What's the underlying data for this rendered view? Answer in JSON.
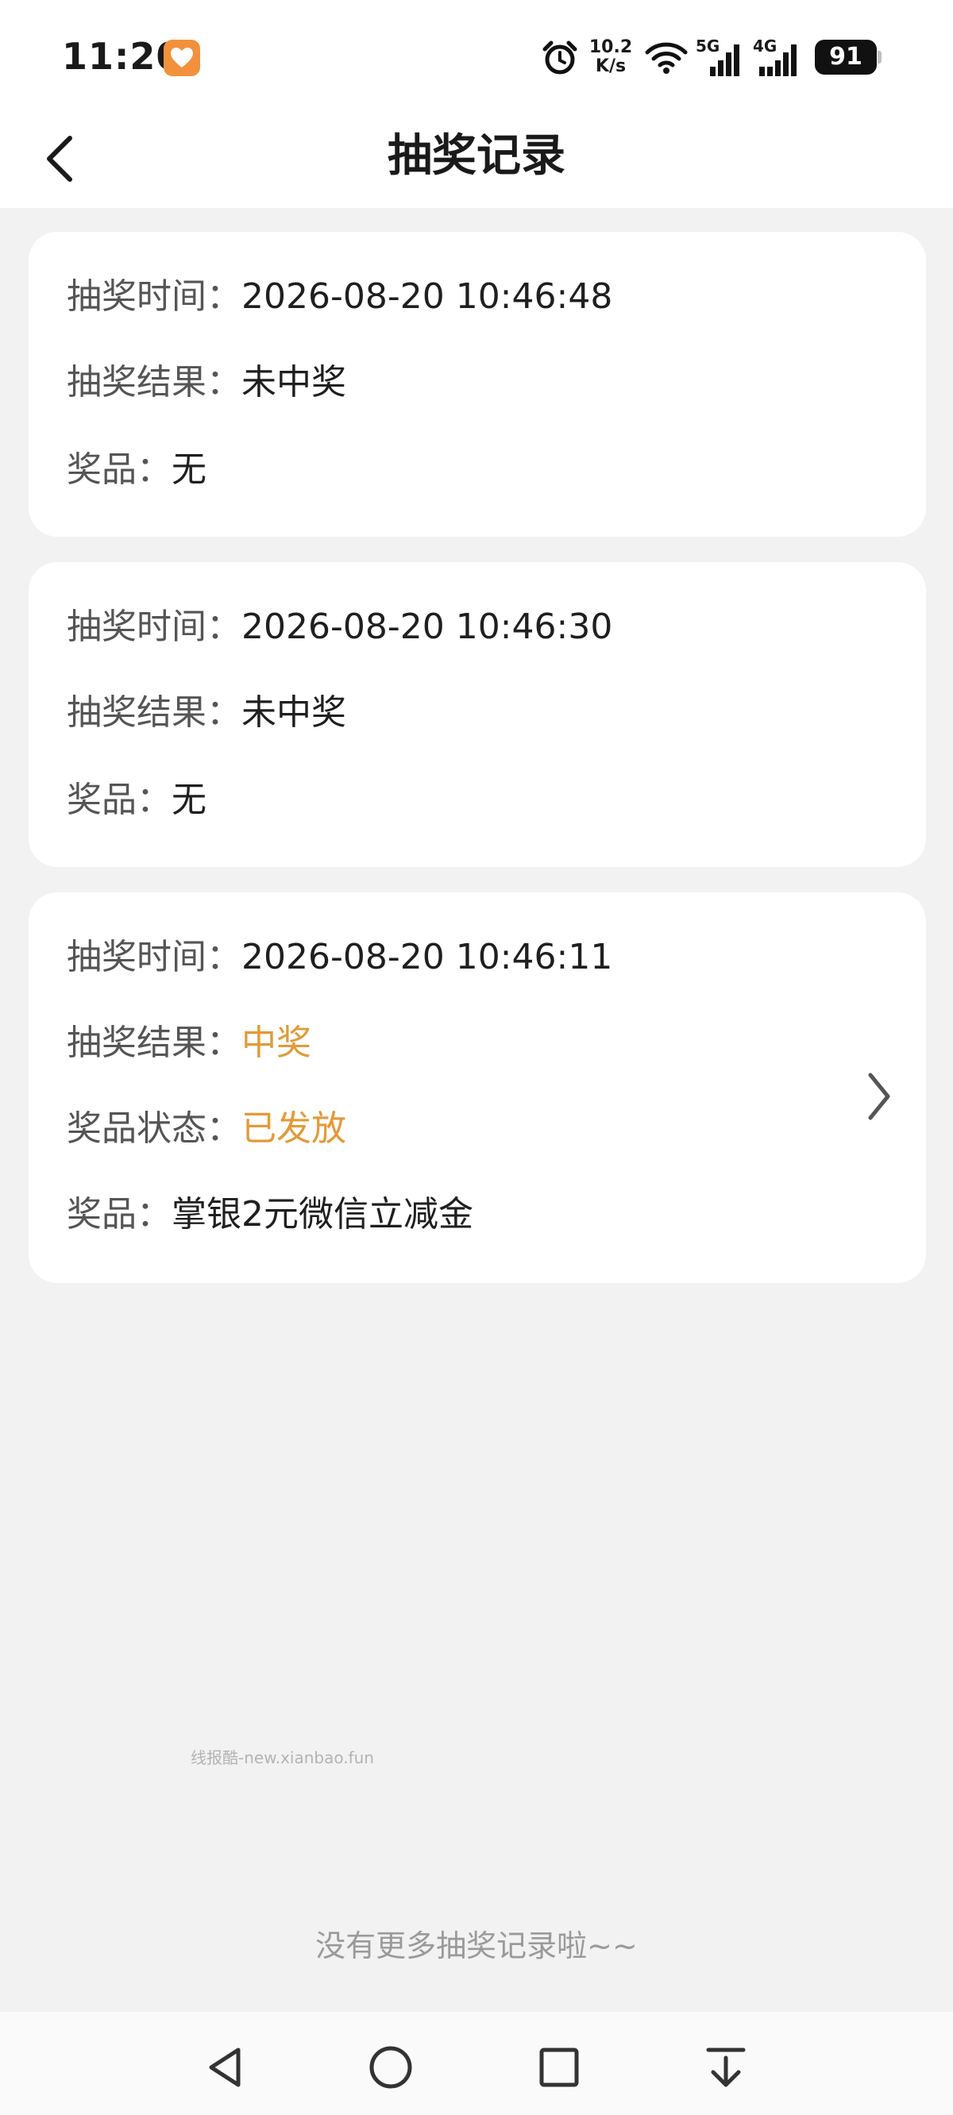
{
  "status_bar": {
    "time": "11:20",
    "app_badge_icon": "heart-app-icon",
    "net_speed_value": "10.2",
    "net_speed_unit": "K/s",
    "signal_1_label": "5G",
    "signal_2_label": "4G",
    "battery": "91"
  },
  "header": {
    "title": "抽奖记录",
    "back_icon": "chevron-left-icon"
  },
  "records": [
    {
      "time_label": "抽奖时间：",
      "time_value": "2026-08-20 10:46:48",
      "result_label": "抽奖结果：",
      "result_value": "未中奖",
      "prize_label": "奖品：",
      "prize_value": "无"
    },
    {
      "time_label": "抽奖时间：",
      "time_value": "2026-08-20 10:46:30",
      "result_label": "抽奖结果：",
      "result_value": "未中奖",
      "prize_label": "奖品：",
      "prize_value": "无"
    },
    {
      "time_label": "抽奖时间：",
      "time_value": "2026-08-20 10:46:11",
      "result_label": "抽奖结果：",
      "result_value": "中奖",
      "status_label": "奖品状态：",
      "status_value": "已发放",
      "prize_label": "奖品：",
      "prize_value": "掌银2元微信立减金"
    }
  ],
  "highlight_color": "#e39a37",
  "watermark": "线报酷-new.xianbao.fun",
  "footer": "没有更多抽奖记录啦~~"
}
